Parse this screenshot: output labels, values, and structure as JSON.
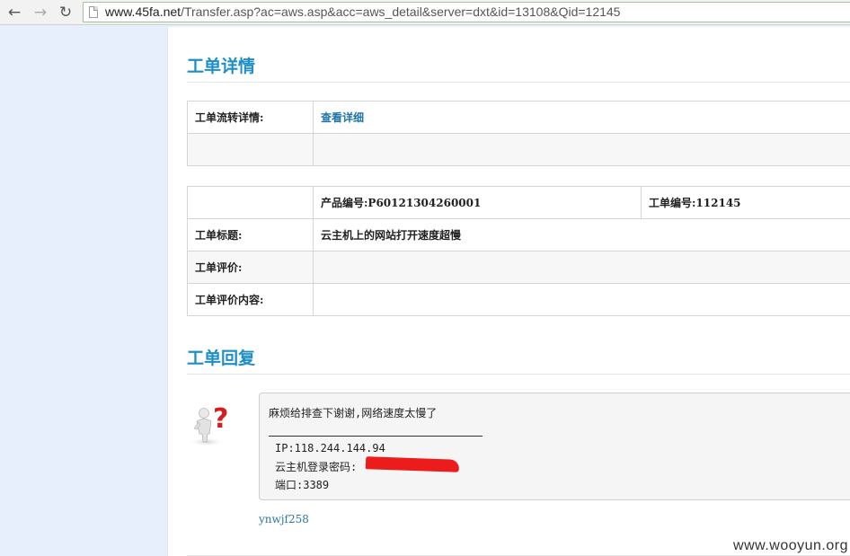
{
  "browser": {
    "url_host": "www.45fa.net",
    "url_path": "/Transfer.asp?ac=aws.asp&acc=aws_detail&server=dxt&id=13108&Qid=12145",
    "icons": {
      "back": "back-arrow-icon",
      "forward": "forward-arrow-icon",
      "reload": "reload-icon",
      "page": "page-icon"
    }
  },
  "detail": {
    "title": "工单详情",
    "flow_label": "工单流转详情:",
    "flow_link": "查看详细"
  },
  "ticket": {
    "product_no": "产品编号:P60121304260001",
    "ticket_no": "工单编号:112145",
    "title_label": "工单标题:",
    "title_value": "云主机上的网站打开速度超慢",
    "rating_label": "工单评价:",
    "rating_content_label": "工单评价内容:"
  },
  "reply": {
    "title": "工单回复",
    "message": "麻烦给排查下谢谢,网络速度太慢了",
    "ip_line": "IP:118.244.144.94",
    "password_line": "云主机登录密码:",
    "port_line": "端口:3389",
    "author": "ynwjf258",
    "avatar_icon": "question-person-icon",
    "redaction_color": "#ec1c1c"
  },
  "watermark": "www.wooyun.org",
  "colors": {
    "accent": "#1e8fc6",
    "ticket_text": "#a33a3a",
    "link": "#1e73a8",
    "sidebar": "#e7effc"
  }
}
